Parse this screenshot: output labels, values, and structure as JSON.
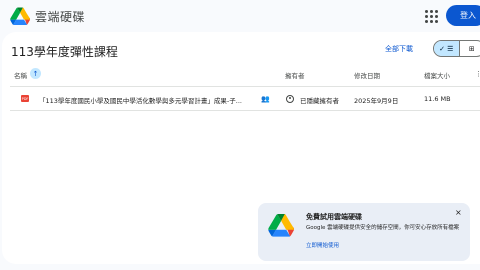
{
  "header": {
    "app_title": "雲端硬碟",
    "signin_label": "登入",
    "apps_icon": "grid-apps-icon",
    "brand_colors": {
      "green": "#0f9d58",
      "blue": "#4285f4",
      "yellow": "#fbbc04",
      "red": "#ea4335"
    }
  },
  "folder": {
    "title": "113學年度彈性課程",
    "download_all": "全部下載",
    "view_toggle": {
      "list_icon": "✓ ☰",
      "grid_icon": "⊞",
      "active": "list"
    }
  },
  "table": {
    "columns": {
      "name": "名稱",
      "owner": "擁有者",
      "modified": "修改日期",
      "size": "檔案大小"
    },
    "sort_icon": "↑",
    "rows": [
      {
        "type_icon": "PDF",
        "name": "「113學年度國民小學及國民中學活化數學與多元學習計畫」成果-子...",
        "shared_icon": "people-icon",
        "owner": "已隱藏擁有者",
        "modified": "2025年9月9日",
        "size": "11.6 MB"
      }
    ]
  },
  "promo": {
    "title": "免費試用雲端硬碟",
    "body": "Google 雲端硬碟提供安全的儲存空間，你可安心存放所有檔案",
    "link": "立即開始使用",
    "close": "×"
  }
}
